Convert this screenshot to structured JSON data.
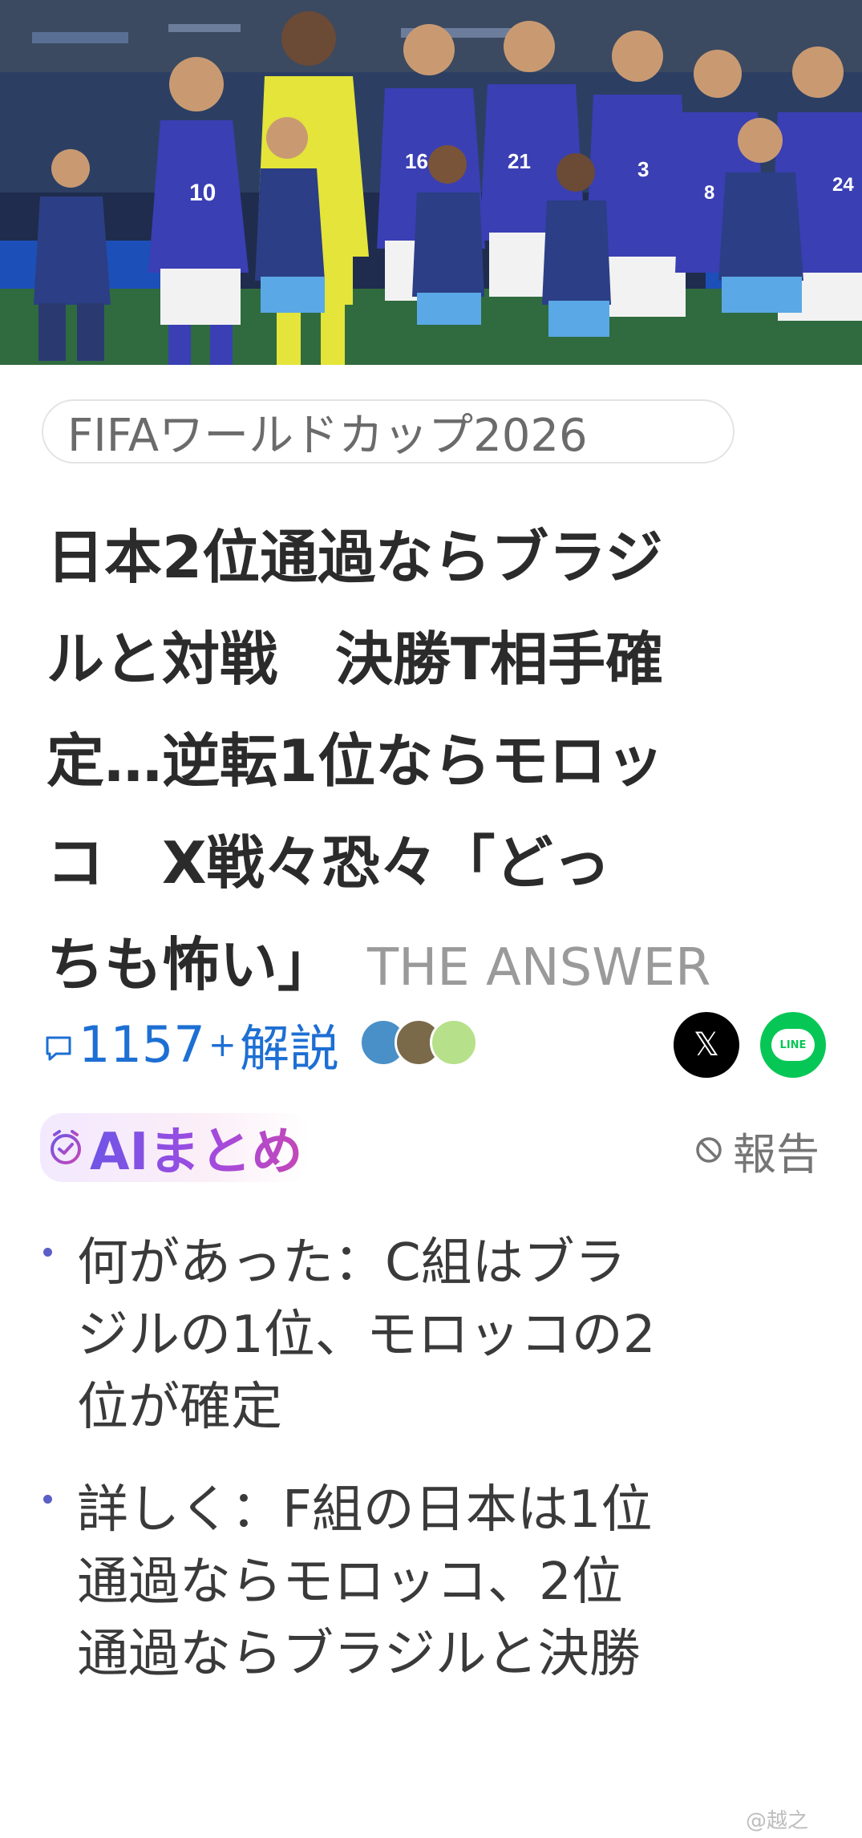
{
  "hero": {
    "players": [
      {
        "number": "10"
      },
      {
        "number": "16"
      },
      {
        "number": "21"
      },
      {
        "number": "3"
      },
      {
        "number": "8"
      },
      {
        "number": "24"
      }
    ],
    "colors": {
      "kit_blue": "#3a3fb4",
      "shorts_white": "#f2f2f2",
      "keeper_yellow": "#e4e43a",
      "kid_kit": "#2c3e85"
    }
  },
  "tag": {
    "label": "FIFAワールドカップ2026"
  },
  "headline": {
    "lines": [
      "日本2位通過ならブラジ",
      "ルと対戦　決勝T相手確",
      "定…逆転1位ならモロッ",
      "コ　X戦々恐々「どっ"
    ],
    "last_line": "ちも怖い」",
    "source": "THE ANSWER"
  },
  "meta": {
    "comment_icon": "comment-icon",
    "comment_count": "1157",
    "comment_plus": "+",
    "comment_suffix": "解説",
    "avatar_colors": [
      "#4a90c8",
      "#7a6a4a",
      "#b6e08a"
    ],
    "share_x_label": "𝕏",
    "share_line_label": "LINE",
    "colors": {
      "link_blue": "#1d6fd3",
      "line_green": "#06c755"
    }
  },
  "ai_summary": {
    "icon": "ai-clock-icon",
    "label": "AIまとめ",
    "report_icon": "ban-icon",
    "report_label": "報告",
    "accent": "#7a49e0"
  },
  "bullets": [
    {
      "lines": [
        "何があった：C組はブラ",
        "ジルの1位、モロッコの2",
        "位が確定"
      ]
    },
    {
      "lines": [
        "詳しく：F組の日本は1位",
        "通過ならモロッコ、2位",
        "通過ならブラジルと決勝"
      ]
    }
  ],
  "watermark": "@越之"
}
